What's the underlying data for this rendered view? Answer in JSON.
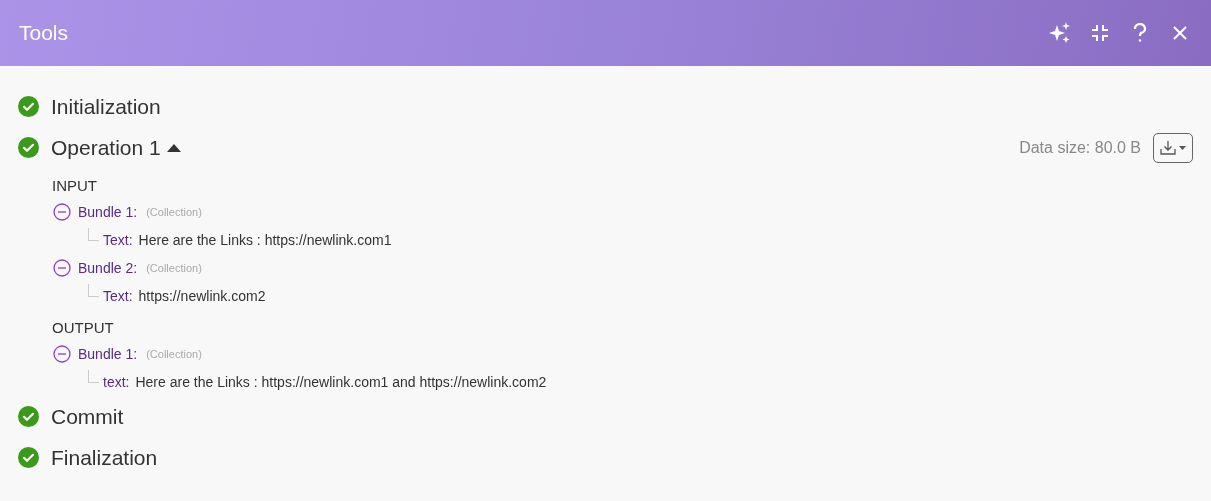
{
  "window": {
    "title": "Tools"
  },
  "steps": [
    {
      "label": "Initialization",
      "done": true
    },
    {
      "label": "Operation 1",
      "done": true,
      "expanded": true,
      "data_size": "Data size: 80.0 B",
      "sections": [
        {
          "title": "INPUT",
          "bundles": [
            {
              "label": "Bundle 1:",
              "type": "(Collection)",
              "expanded": true,
              "children": [
                {
                  "key": "Text:",
                  "value": "Here are the Links : https://newlink.com1"
                }
              ]
            },
            {
              "label": "Bundle 2:",
              "type": "(Collection)",
              "expanded": true,
              "children": [
                {
                  "key": "Text:",
                  "value": "https://newlink.com2"
                }
              ]
            }
          ]
        },
        {
          "title": "OUTPUT",
          "bundles": [
            {
              "label": "Bundle 1:",
              "type": "(Collection)",
              "expanded": true,
              "children": [
                {
                  "key": "text:",
                  "value": "Here are the Links : https://newlink.com1 and https://newlink.com2"
                }
              ]
            }
          ]
        }
      ]
    },
    {
      "label": "Commit",
      "done": true
    },
    {
      "label": "Finalization",
      "done": true
    }
  ]
}
